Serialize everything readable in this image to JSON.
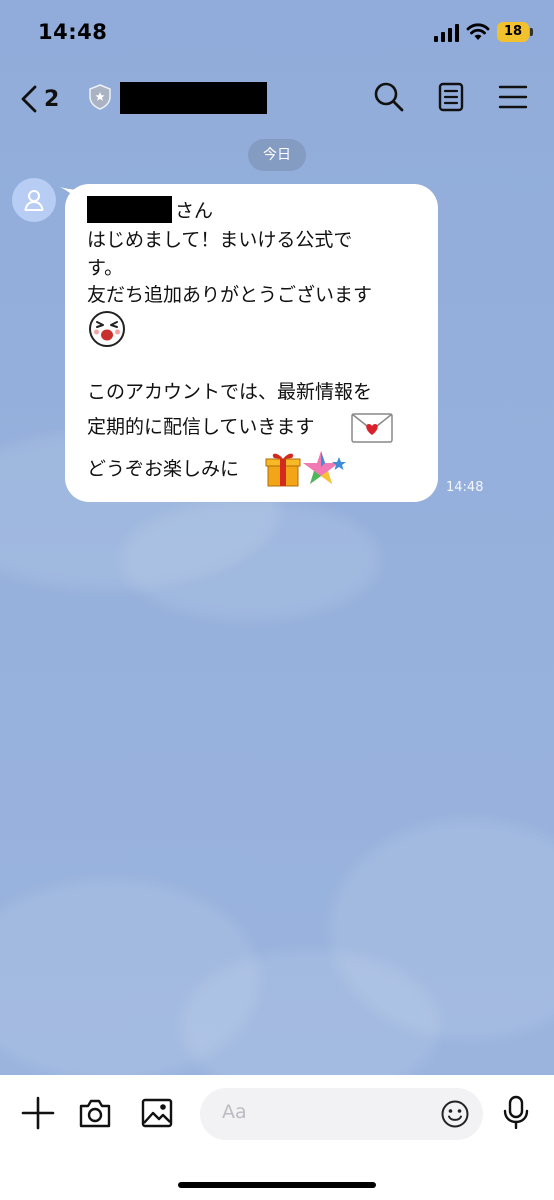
{
  "status_bar": {
    "time": "14:48",
    "battery": "18"
  },
  "header": {
    "back_count": "2",
    "icons": [
      "search-icon",
      "notes-icon",
      "menu-icon"
    ]
  },
  "chat": {
    "date_label": "今日",
    "message": {
      "name_suffix": "さん",
      "lines": [
        "はじめまして！まいける公式で",
        "す。",
        "友だち追加ありがとうございます",
        "このアカウントでは、最新情報を",
        "定期的に配信していきます",
        "どうぞお楽しみに"
      ],
      "emojis": [
        "laughing-face-emoji",
        "love-letter-emoji",
        "gift-emoji",
        "star-emoji"
      ]
    },
    "timestamp": "14:48"
  },
  "input_bar": {
    "placeholder": "Aa",
    "icons": [
      "plus-icon",
      "camera-icon",
      "image-icon",
      "smiley-icon",
      "microphone-icon"
    ]
  },
  "colors": {
    "chat_background": "#93aed9",
    "bubble": "#ffffff",
    "battery": "#f2c12e",
    "avatar": "#b7cdf3"
  }
}
